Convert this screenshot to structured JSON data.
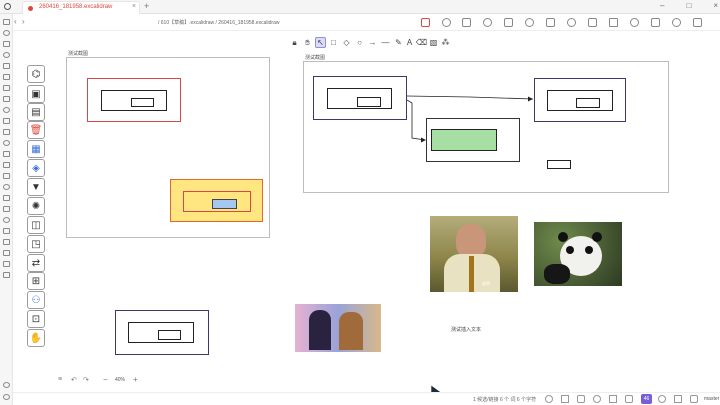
{
  "window": {
    "tab_title": "260416_181958.excalidraw",
    "breadcrumb": "/ 610【草稿】.excalidraw / 260416_181958.excalidraw"
  },
  "canvas": {
    "frame1_label": "测试截图",
    "frame2_label": "测试截图",
    "text_note": "测试插入文本",
    "photo1_caption": "说明",
    "zoom": "40%"
  },
  "statusbar": {
    "text": "1 候选/链接 6 个 词 6 个字符",
    "right_badge": "46",
    "lang": "master"
  },
  "colors": {
    "accent_red": "#e0463b",
    "selected_fill": "#a6dea3",
    "yellow_fill": "#ffe680",
    "blue_fill": "#a5c8f0",
    "purple_badge": "#7a5cd6"
  },
  "toolbar_icons": [
    "lock-icon",
    "hand-icon",
    "selection-icon",
    "rectangle-icon",
    "diamond-icon",
    "ellipse-icon",
    "arrow-icon",
    "line-icon",
    "draw-icon",
    "text-icon",
    "image-icon",
    "eraser-icon",
    "more-tools-icon"
  ],
  "side_tools": [
    "shapes-icon",
    "library-icon",
    "table-icon",
    "delete-icon",
    "grid-icon",
    "pattern-icon",
    "brush-icon",
    "sun-icon",
    "map-icon",
    "frame-icon",
    "swap-icon",
    "monitor-icon",
    "network-icon",
    "lock-icon",
    "hand-icon"
  ]
}
